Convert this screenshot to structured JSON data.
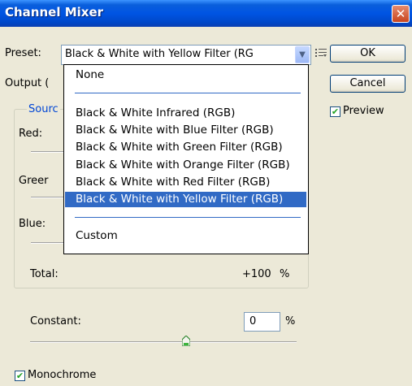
{
  "window": {
    "title": "Channel Mixer",
    "close_glyph": "✕"
  },
  "preset": {
    "label": "Preset:",
    "value": "Black & White with Yellow Filter (RG",
    "arrow_icon": "chevron-down-icon"
  },
  "buttons": {
    "ok": "OK",
    "cancel": "Cancel"
  },
  "preview": {
    "label": "Preview",
    "checked": true
  },
  "output_label": "Output (",
  "source": {
    "group_label": "Sourc",
    "red_label": "Red:",
    "green_label": "Greer",
    "blue_label": "Blue:",
    "total_label": "Total:",
    "total_value": "+100",
    "total_unit": "%"
  },
  "dropdown": {
    "items": [
      {
        "label": "None",
        "selected": false
      },
      {
        "label": "Black & White Infrared (RGB)",
        "selected": false
      },
      {
        "label": "Black & White with Blue Filter (RGB)",
        "selected": false
      },
      {
        "label": "Black & White with Green Filter (RGB)",
        "selected": false
      },
      {
        "label": "Black & White with Orange Filter (RGB)",
        "selected": false
      },
      {
        "label": "Black & White with Red Filter (RGB)",
        "selected": false
      },
      {
        "label": "Black & White with Yellow Filter (RGB)",
        "selected": true
      },
      {
        "label": "Custom",
        "selected": false
      }
    ]
  },
  "constant": {
    "label": "Constant:",
    "value": "0",
    "unit": "%",
    "slider_fraction": 0.5
  },
  "monochrome": {
    "label": "Monochrome",
    "checked": true
  },
  "colors": {
    "titlebar": "#0054e3",
    "highlight": "#316ac5",
    "dialog_bg": "#ece9d8"
  }
}
